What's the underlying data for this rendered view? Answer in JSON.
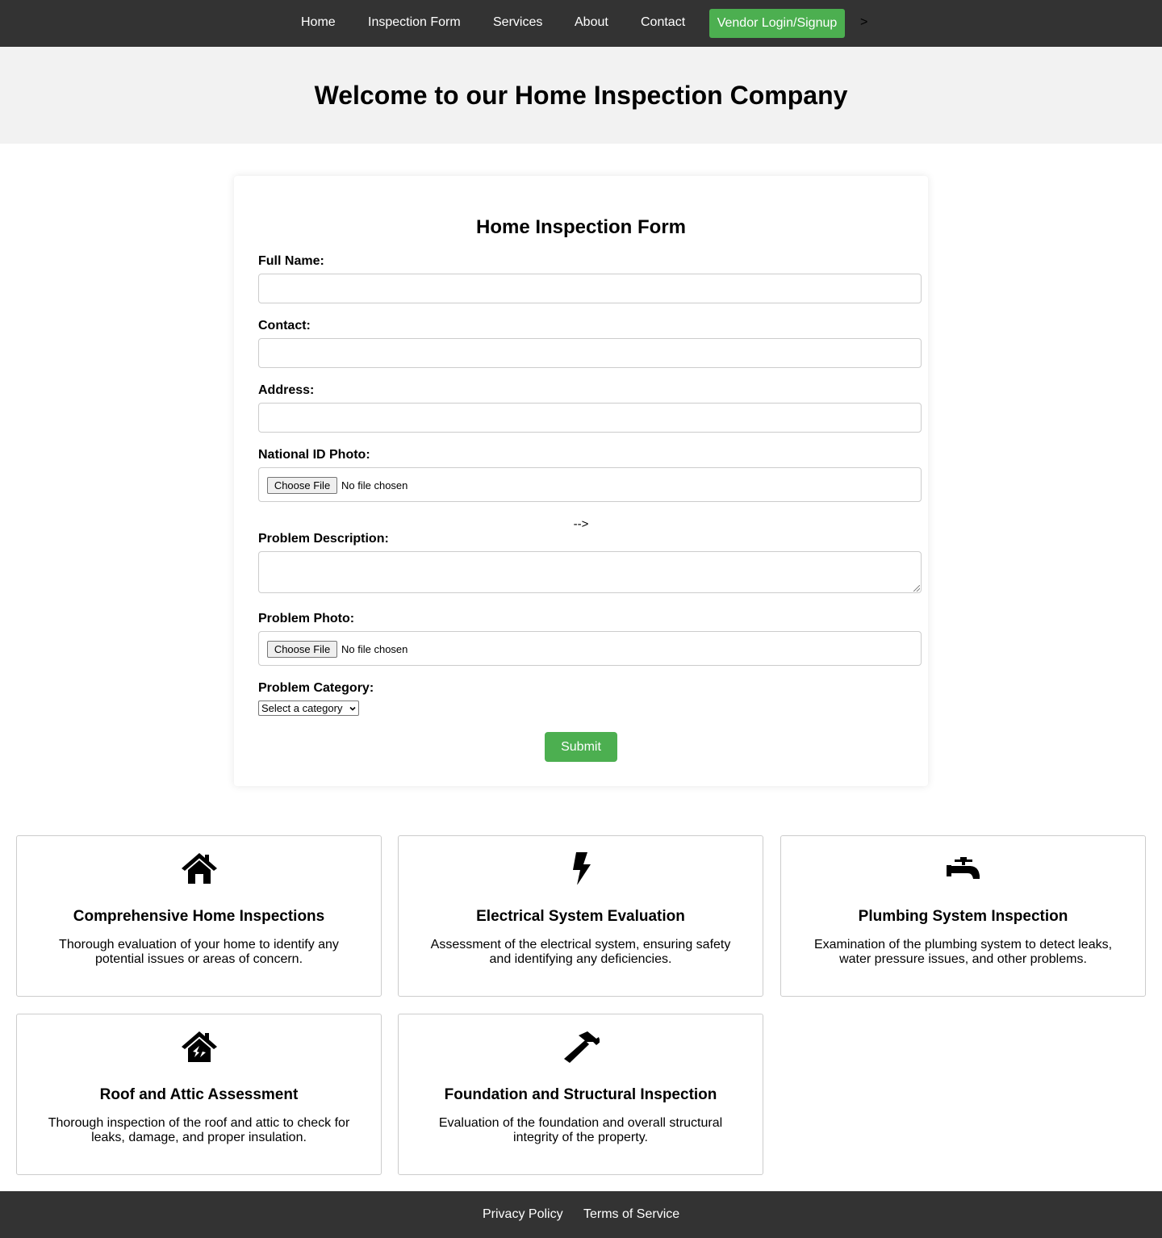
{
  "nav": {
    "items": [
      {
        "label": "Home"
      },
      {
        "label": "Inspection Form"
      },
      {
        "label": "Services"
      },
      {
        "label": "About"
      },
      {
        "label": "Contact"
      }
    ],
    "vendor_button": "Vendor Login/Signup",
    "stray_text": ">"
  },
  "hero": {
    "title": "Welcome to our Home Inspection Company"
  },
  "form": {
    "title": "Home Inspection Form",
    "full_name_label": "Full Name:",
    "contact_label": "Contact:",
    "address_label": "Address:",
    "national_id_label": "National ID Photo:",
    "national_id_button": "Choose File",
    "national_id_status": "No file chosen",
    "stray_comment": "-->",
    "problem_description_label": "Problem Description:",
    "problem_photo_label": "Problem Photo:",
    "problem_photo_button": "Choose File",
    "problem_photo_status": "No file chosen",
    "problem_category_label": "Problem Category:",
    "problem_category_selected": "Select a category",
    "submit_label": "Submit"
  },
  "services": [
    {
      "icon": "house-icon",
      "title": "Comprehensive Home Inspections",
      "description": "Thorough evaluation of your home to identify any potential issues or areas of concern."
    },
    {
      "icon": "bolt-icon",
      "title": "Electrical System Evaluation",
      "description": "Assessment of the electrical system, ensuring safety and identifying any deficiencies."
    },
    {
      "icon": "faucet-icon",
      "title": "Plumbing System Inspection",
      "description": "Examination of the plumbing system to detect leaks, water pressure issues, and other problems."
    },
    {
      "icon": "house-chimney-icon",
      "title": "Roof and Attic Assessment",
      "description": "Thorough inspection of the roof and attic to check for leaks, damage, and proper insulation."
    },
    {
      "icon": "hammer-icon",
      "title": "Foundation and Structural Inspection",
      "description": "Evaluation of the foundation and overall structural integrity of the property."
    }
  ],
  "footer": {
    "privacy": "Privacy Policy",
    "terms": "Terms of Service"
  },
  "colors": {
    "nav_bg": "#333333",
    "accent": "#4caf50",
    "hero_bg": "#f2f2f2",
    "border": "#cccccc"
  }
}
